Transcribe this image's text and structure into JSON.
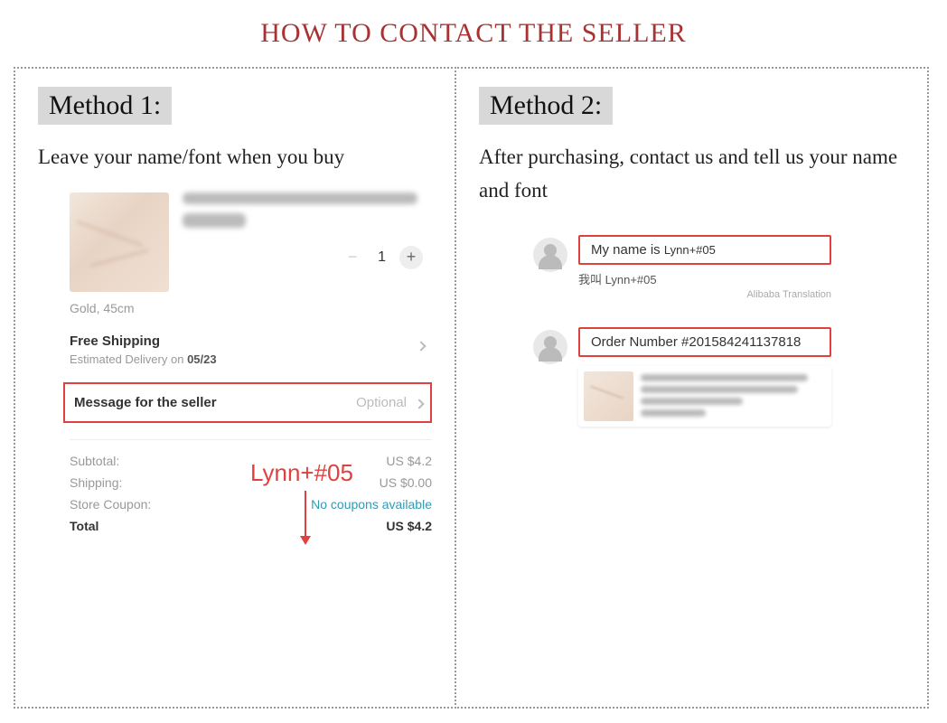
{
  "title": "HOW TO CONTACT THE SELLER",
  "method1": {
    "label": "Method 1:",
    "desc": "Leave your name/font when you buy",
    "variant": "Gold, 45cm",
    "qty": "1",
    "shipping_title": "Free Shipping",
    "shipping_est_prefix": "Estimated Delivery on ",
    "shipping_est_date": "05/23",
    "annotation": "Lynn+#05",
    "msg_label": "Message for the seller",
    "msg_placeholder": "Optional",
    "subtotal_label": "Subtotal:",
    "subtotal_val": "US $4.2",
    "shipping_label": "Shipping:",
    "shipping_val": "US $0.00",
    "coupon_label": "Store Coupon:",
    "coupon_val": "No coupons available",
    "total_label": "Total",
    "total_val": "US $4.2"
  },
  "method2": {
    "label": "Method 2:",
    "desc": "After purchasing, contact us and tell us your name and font",
    "msg1_prefix": "My name is ",
    "msg1_name": "Lynn+#05",
    "msg1_translation": "我叫 Lynn+#05",
    "translation_src": "Alibaba Translation",
    "msg2": "Order Number #201584241137818"
  }
}
